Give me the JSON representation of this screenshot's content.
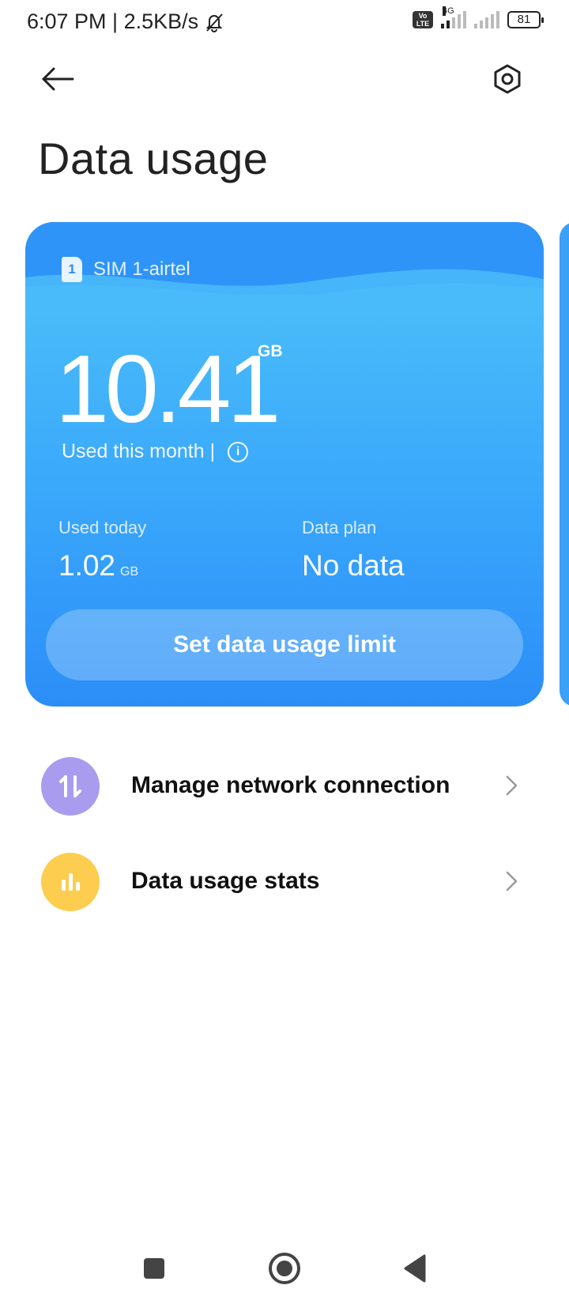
{
  "status_bar": {
    "time_speed": "6:07 PM | 2.5KB/s",
    "network_type": "4G",
    "volte_label": "Vo LTE",
    "battery": "81"
  },
  "header": {
    "title": "Data usage"
  },
  "sim_card": {
    "sim_number": "1",
    "sim_label": "SIM 1-airtel",
    "used_this_month_value": "10.41",
    "used_this_month_unit": "GB",
    "used_this_month_label": "Used this month |",
    "used_today_label": "Used today",
    "used_today_value": "1.02",
    "used_today_unit": "GB",
    "data_plan_label": "Data plan",
    "data_plan_value": "No data",
    "limit_button_label": "Set data usage limit"
  },
  "menu": [
    {
      "label": "Manage network connection",
      "icon": "up-down-arrows-icon",
      "color": "#a99bee"
    },
    {
      "label": "Data usage stats",
      "icon": "bar-chart-icon",
      "color": "#fdcd4f"
    }
  ],
  "colors": {
    "card_top": "#3ba3f7",
    "card_bottom": "#2b8ef8"
  }
}
